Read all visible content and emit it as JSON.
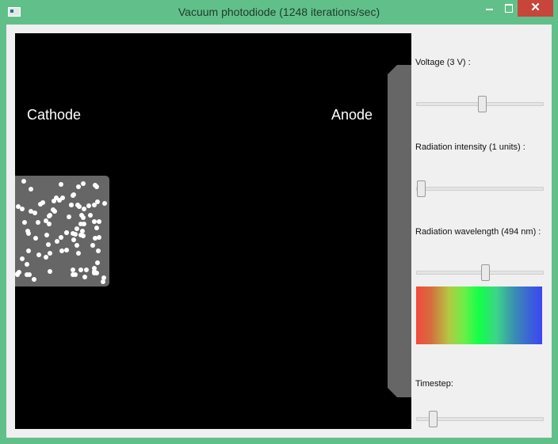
{
  "window": {
    "title": "Vacuum photodiode (1248 iterations/sec)",
    "minimize_label": "",
    "maximize_label": "",
    "close_label": "✕"
  },
  "canvas": {
    "cathode_label": "Cathode",
    "anode_label": "Anode",
    "colors": {
      "background": "#000000",
      "plate": "#666666",
      "electron": "#ffffff"
    }
  },
  "controls": {
    "voltage": {
      "label": "Voltage (3 V) :",
      "value": 3,
      "position_fraction": 0.52
    },
    "intensity": {
      "label": "Radiation intensity (1 units) :",
      "value": 1,
      "position_fraction": 0.0
    },
    "wavelength": {
      "label": "Radiation wavelength (494 nm) :",
      "value": 494,
      "position_fraction": 0.55
    },
    "spectrum_bar": {
      "colors": [
        "#f3493c",
        "#6bef48",
        "#12ff48",
        "#3a8db2",
        "#3d46f2"
      ]
    },
    "timestep": {
      "label": "Timestep:",
      "position_fraction": 0.1
    }
  },
  "theme": {
    "titlebar": "#61c08a",
    "panel": "#f0f0f0",
    "close_button": "#c7453a"
  }
}
